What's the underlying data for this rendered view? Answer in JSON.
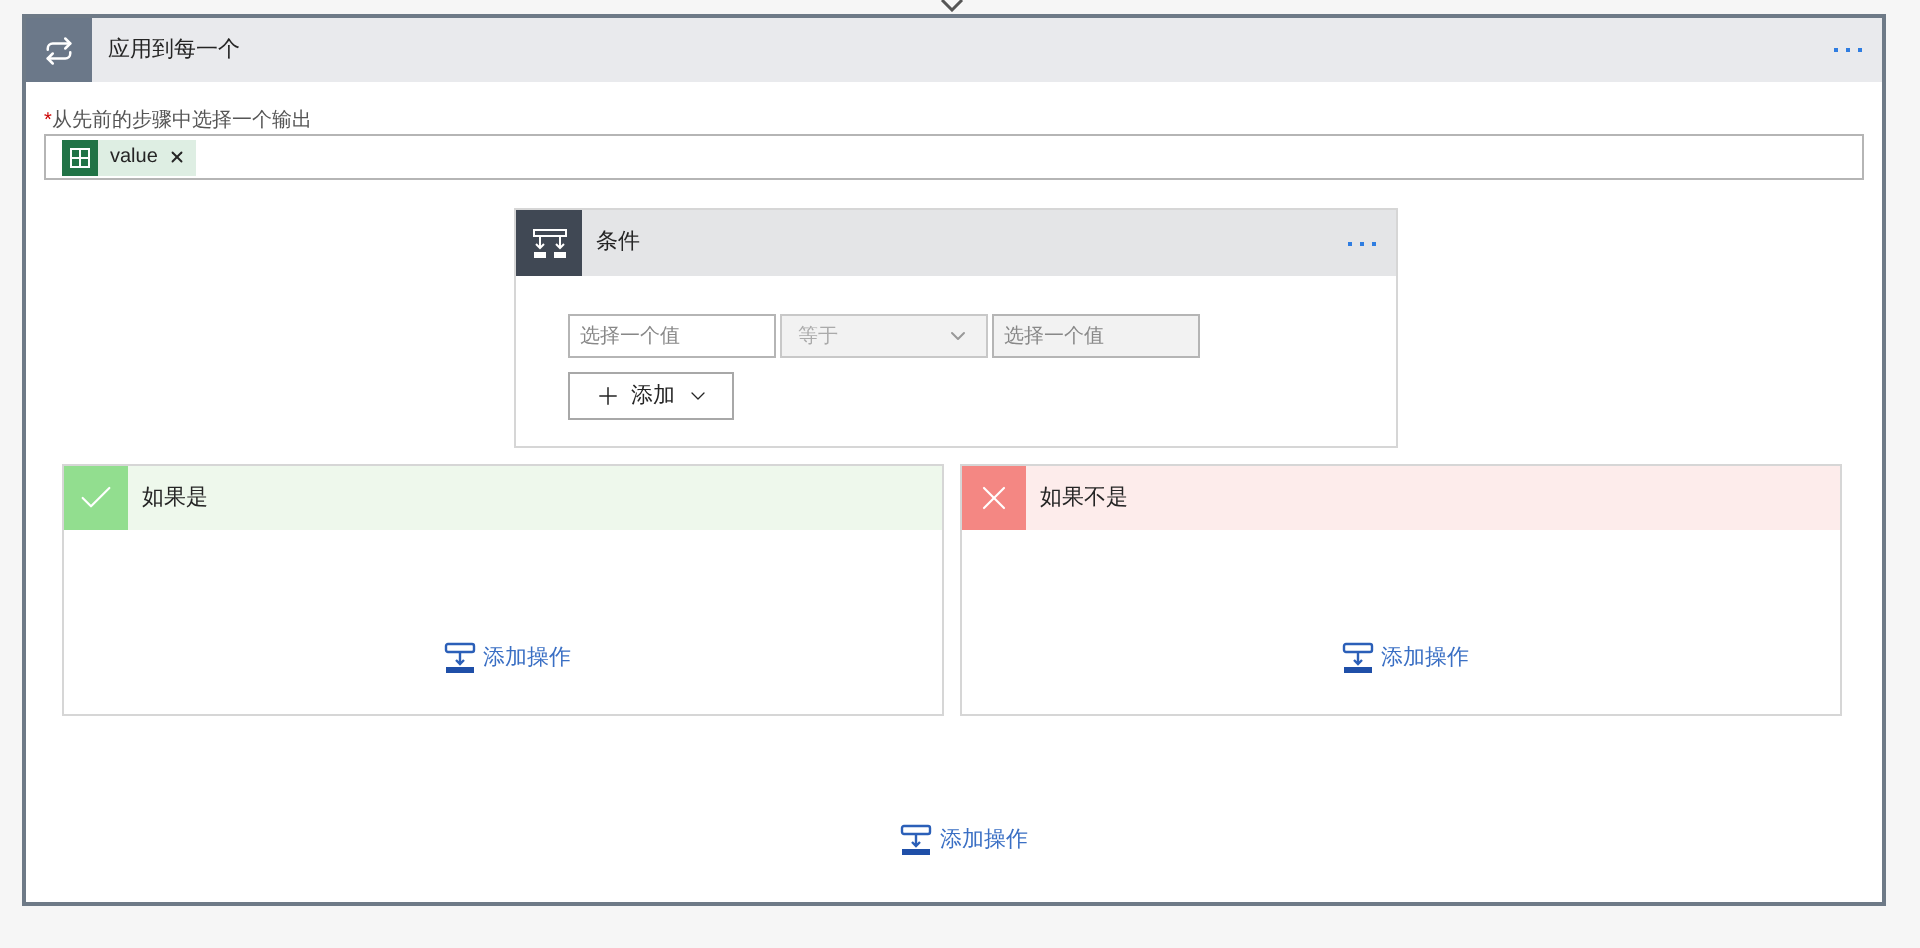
{
  "loop": {
    "title": "应用到每一个"
  },
  "output_field": {
    "required_mark": "*",
    "label": "从先前的步骤中选择一个输出",
    "tokens": [
      {
        "label": "value"
      }
    ]
  },
  "condition": {
    "title": "条件",
    "rows": [
      {
        "left": {
          "placeholder": "选择一个值",
          "disabled": false
        },
        "operator": {
          "value": "等于",
          "disabled": true
        },
        "right": {
          "placeholder": "选择一个值",
          "disabled": true
        }
      }
    ],
    "add_button": "添加"
  },
  "branches": [
    {
      "kind": "yes",
      "title": "如果是",
      "add_action": "添加操作"
    },
    {
      "kind": "no",
      "title": "如果不是",
      "add_action": "添加操作"
    }
  ],
  "add_action": "添加操作"
}
